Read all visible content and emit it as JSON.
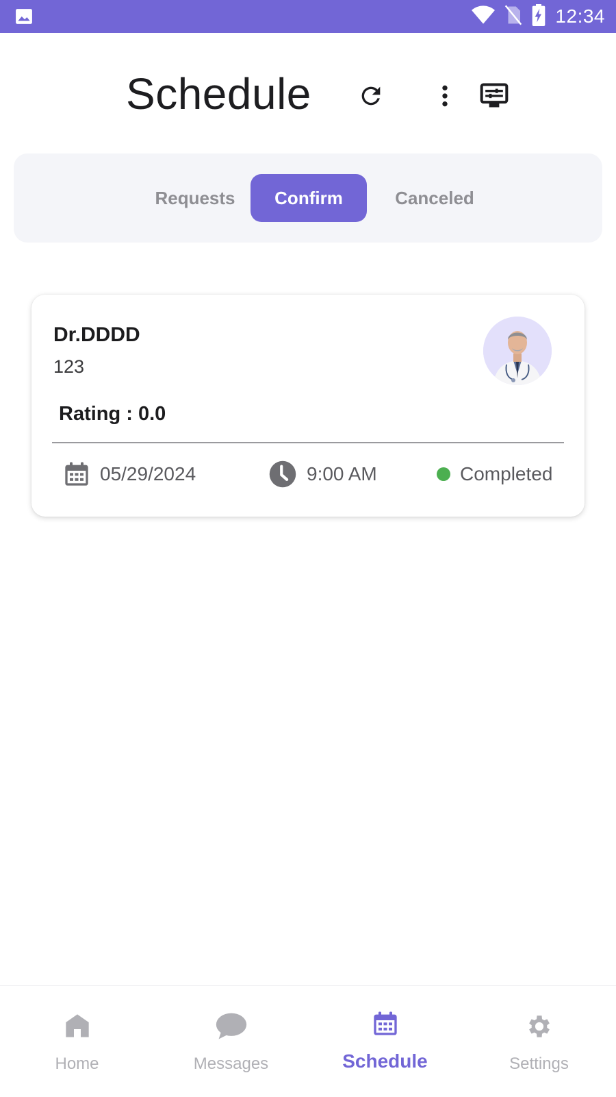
{
  "status_bar": {
    "time": "12:34"
  },
  "header": {
    "title": "Schedule"
  },
  "tabs": [
    {
      "label": "Requests",
      "active": false
    },
    {
      "label": "Confirm",
      "active": true
    },
    {
      "label": "Canceled",
      "active": false
    }
  ],
  "appointment": {
    "doctor_name": "Dr.DDDD",
    "subtitle": "123",
    "rating_label": "Rating : 0.0",
    "date": "05/29/2024",
    "time": "9:00 AM",
    "status": "Completed"
  },
  "bottom_nav": [
    {
      "label": "Home",
      "icon": "home-icon",
      "active": false
    },
    {
      "label": "Messages",
      "icon": "chat-bubble-icon",
      "active": false
    },
    {
      "label": "Schedule",
      "icon": "calendar-icon",
      "active": true
    },
    {
      "label": "Settings",
      "icon": "gear-icon",
      "active": false
    }
  ],
  "colors": {
    "accent": "#7266d6",
    "status_completed": "#4caf50",
    "inactive": "#b0b0b5"
  }
}
